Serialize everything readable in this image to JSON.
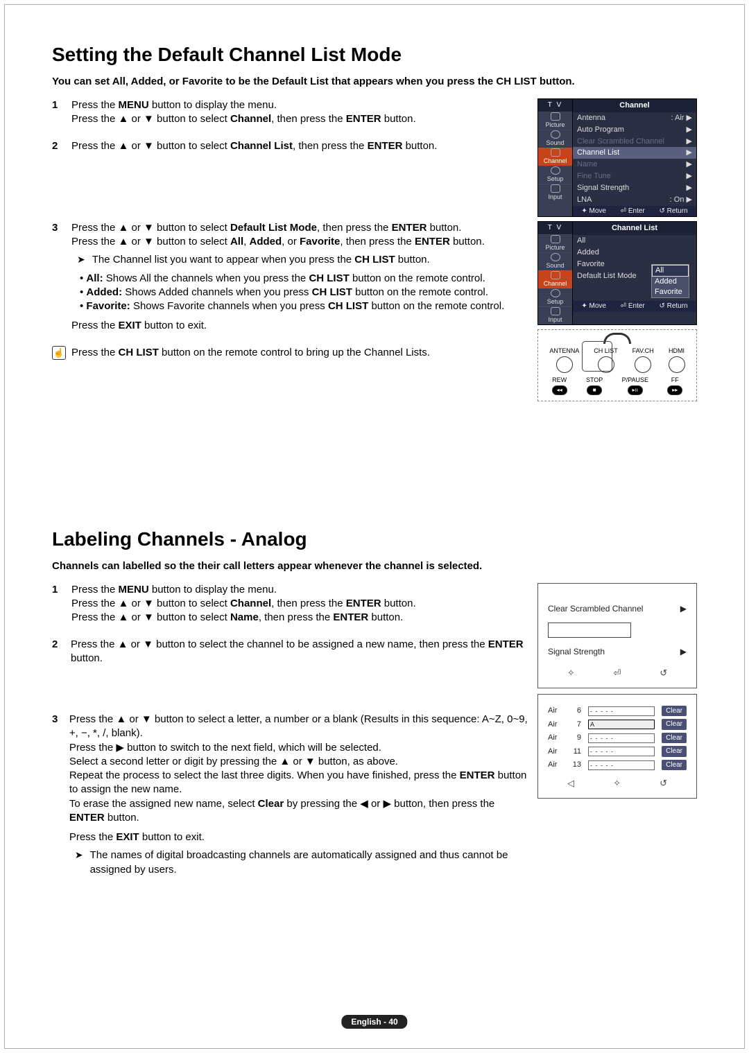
{
  "page": {
    "footer": "English - 40"
  },
  "section1": {
    "title": "Setting the Default Channel List Mode",
    "intro": "You can set All, Added, or Favorite to be the Default List that appears when you press the CH LIST button.",
    "step1": {
      "num": "1",
      "line1a": "Press the ",
      "line1b": "MENU",
      "line1c": " button to display the menu.",
      "line2a": "Press the ▲ or ▼ button to select ",
      "line2b": "Channel",
      "line2c": ", then press the ",
      "line2d": "ENTER",
      "line2e": " button."
    },
    "step2": {
      "num": "2",
      "line1a": "Press the ▲ or ▼ button to select ",
      "line1b": "Channel List",
      "line1c": ", then press the ",
      "line1d": "ENTER",
      "line1e": " button."
    },
    "step3": {
      "num": "3",
      "line1a": "Press the ▲ or ▼ button to select ",
      "line1b": "Default List Mode",
      "line1c": ", then press the ",
      "line1d": "ENTER",
      "line1e": " button.",
      "line2a": "Press the ▲ or ▼ button to select ",
      "line2b": "All",
      "line2c": ", ",
      "line2d": "Added",
      "line2e": ", or ",
      "line2f": "Favorite",
      "line2g": ", then press the ",
      "line2h": "ENTER",
      "line2i": " button.",
      "noteA": "The Channel list you want to appear when you press the ",
      "noteB": "CH LIST",
      "noteC": " button.",
      "bullet1a": "All:",
      "bullet1b": " Shows All the channels when you press the ",
      "bullet1c": "CH LIST",
      "bullet1d": " button on the remote control.",
      "bullet2a": "Added:",
      "bullet2b": " Shows Added channels when you press ",
      "bullet2c": "CH LIST",
      "bullet2d": " button on the remote control.",
      "bullet3a": "Favorite:",
      "bullet3b": " Shows Favorite channels when you press ",
      "bullet3c": "CH LIST",
      "bullet3d": " button on the remote control.",
      "exitA": "Press the ",
      "exitB": "EXIT",
      "exitC": " button to exit.",
      "tipA": "Press the ",
      "tipB": "CH LIST",
      "tipC": " button on the remote control to bring up the Channel Lists."
    }
  },
  "osd1": {
    "tv": "T V",
    "side": [
      "Picture",
      "Sound",
      "Channel",
      "Setup",
      "Input"
    ],
    "title": "Channel",
    "items": [
      {
        "label": "Antenna",
        "value": ": Air"
      },
      {
        "label": "Auto Program",
        "value": ""
      },
      {
        "label": "Clear Scrambled Channel",
        "value": "",
        "disabled": true
      },
      {
        "label": "Channel List",
        "value": "",
        "hl": true
      },
      {
        "label": "Name",
        "value": "",
        "disabled": true
      },
      {
        "label": "Fine Tune",
        "value": "",
        "disabled": true
      },
      {
        "label": "Signal Strength",
        "value": ""
      },
      {
        "label": "LNA",
        "value": ": On"
      }
    ],
    "footer": {
      "move": "Move",
      "enter": "Enter",
      "return": "Return"
    }
  },
  "osd2": {
    "tv": "T V",
    "side": [
      "Picture",
      "Sound",
      "Channel",
      "Setup",
      "Input"
    ],
    "title": "Channel List",
    "items": [
      {
        "label": "All",
        "value": ""
      },
      {
        "label": "Added",
        "value": ""
      },
      {
        "label": "Favorite",
        "value": ""
      },
      {
        "label": "Default List Mode",
        "value": ""
      }
    ],
    "popup": [
      "All",
      "Added",
      "Favorite"
    ],
    "footer": {
      "move": "Move",
      "enter": "Enter",
      "return": "Return"
    }
  },
  "remote": {
    "row1": [
      "ANTENNA",
      "CH LIST",
      "FAV.CH",
      "HDMI"
    ],
    "row2": [
      "REW",
      "STOP",
      "P/PAUSE",
      "FF"
    ],
    "icons": [
      "◂◂",
      "■",
      "▸ıı",
      "▸▸"
    ]
  },
  "section2": {
    "title": "Labeling Channels - Analog",
    "intro": "Channels can labelled so the their call letters appear whenever the channel is selected.",
    "step1": {
      "num": "1",
      "line1a": "Press the ",
      "line1b": "MENU",
      "line1c": " button to display the menu.",
      "line2a": "Press the ▲ or ▼ button to select ",
      "line2b": "Channel",
      "line2c": ", then press the ",
      "line2d": "ENTER",
      "line2e": " button.",
      "line3a": "Press the ▲ or ▼ button to select ",
      "line3b": "Name",
      "line3c": ", then press the ",
      "line3d": "ENTER",
      "line3e": " button."
    },
    "step2": {
      "num": "2",
      "line1a": "Press the ▲ or ▼ button to select the channel to be assigned a new name, then press the ",
      "line1b": "ENTER",
      "line1c": " button."
    },
    "step3": {
      "num": "3",
      "l1": "Press the ▲ or ▼ button to select a letter, a number or a blank (Results in this sequence: A~Z, 0~9, +, −, *, /, blank).",
      "l2": "Press the ▶ button to switch to the next field, which will be selected.",
      "l3": "Select a second letter or digit by pressing the ▲ or ▼ button, as above.",
      "l4a": "Repeat the process to select the last three digits. When you have finished, press the ",
      "l4b": "ENTER",
      "l4c": " button to assign the new name.",
      "l5a": "To erase the assigned new name, select ",
      "l5b": "Clear",
      "l5c": " by pressing the ◀ or ▶ button, then press the ",
      "l5d": "ENTER",
      "l5e": " button.",
      "exitA": "Press the ",
      "exitB": "EXIT",
      "exitC": " button to exit.",
      "noteA": "The names of digital broadcasting channels are automatically assigned and thus cannot be assigned by users."
    }
  },
  "osd3": {
    "row1": "Clear Scrambled Channel",
    "row2": "Signal Strength"
  },
  "osd4": {
    "src": "Air",
    "rows": [
      {
        "ch": "6",
        "name": "- - - - -",
        "clear": "Clear"
      },
      {
        "ch": "7",
        "name": "A",
        "clear": "Clear"
      },
      {
        "ch": "9",
        "name": "- - - - -",
        "clear": "Clear"
      },
      {
        "ch": "11",
        "name": "- - - - -",
        "clear": "Clear"
      },
      {
        "ch": "13",
        "name": "- - - - -",
        "clear": "Clear"
      }
    ]
  },
  "glyphs": {
    "arrowNote": "➤",
    "moveIcon": "✦",
    "enterIcon": "⏎",
    "returnIcon": "↺",
    "playArrow": "▶",
    "leftRight": "◁",
    "upDown": "✧"
  }
}
